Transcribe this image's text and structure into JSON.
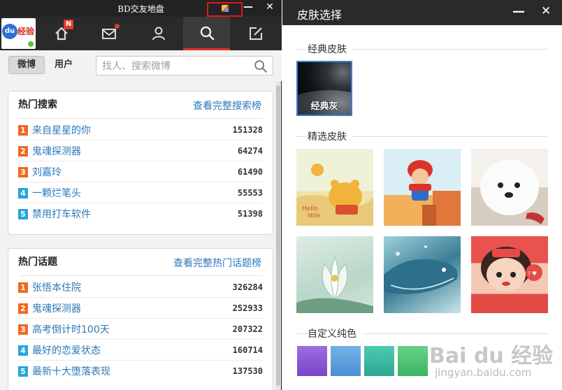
{
  "left_window": {
    "title": "BD交友地盘",
    "nav": {
      "home_badge": "N",
      "avatar_text": {
        "du": "du",
        "jy": "经验"
      }
    },
    "tabs": {
      "weibo": "微博",
      "user": "用户"
    },
    "search": {
      "placeholder": "找人、搜索微博"
    },
    "hot_search": {
      "title": "热门搜索",
      "link": "查看完整搜索榜",
      "items": [
        {
          "rank": "1",
          "text": "来自星星的你",
          "count": "151328"
        },
        {
          "rank": "2",
          "text": "鬼魂探测器",
          "count": "64274"
        },
        {
          "rank": "3",
          "text": "刘嘉玲",
          "count": "61490"
        },
        {
          "rank": "4",
          "text": "一颗烂笔头",
          "count": "55553"
        },
        {
          "rank": "5",
          "text": "禁用打车软件",
          "count": "51398"
        }
      ]
    },
    "hot_topics": {
      "title": "热门话题",
      "link": "查看完整热门话题榜",
      "items": [
        {
          "rank": "1",
          "text": "张悟本住院",
          "count": "326284"
        },
        {
          "rank": "2",
          "text": "鬼魂探测器",
          "count": "252933"
        },
        {
          "rank": "3",
          "text": "高考倒计时100天",
          "count": "207322"
        },
        {
          "rank": "4",
          "text": "最好的恋爱状态",
          "count": "160714"
        },
        {
          "rank": "5",
          "text": "最新十大堕落表现",
          "count": "137530"
        }
      ]
    }
  },
  "right_window": {
    "title": "皮肤选择",
    "classic_section": "经典皮肤",
    "classic_skin_label": "经典灰",
    "featured_section": "精选皮肤",
    "custom_section": "自定义纯色",
    "swatch_colors": [
      "#8a5ad6",
      "#5d9fdc",
      "#3cb9a1",
      "#4fc474"
    ]
  },
  "watermark": {
    "logo": "Bai du 经验",
    "url": "jingyan.baidu.com"
  }
}
